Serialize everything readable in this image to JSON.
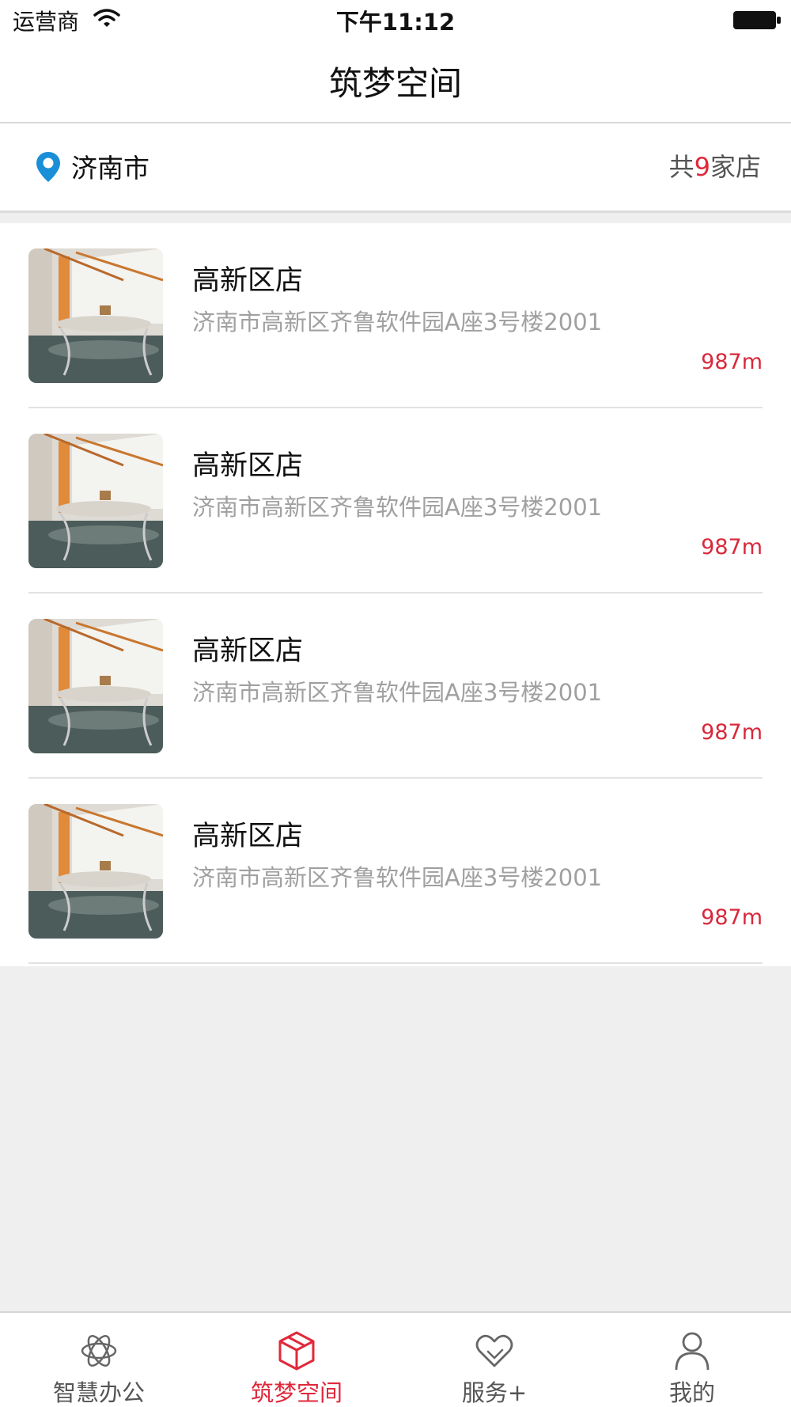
{
  "status_bar": {
    "carrier": "运营商",
    "time": "下午11:12"
  },
  "nav": {
    "title": "筑梦空间"
  },
  "location": {
    "city": "济南市",
    "count_prefix": "共",
    "count": "9",
    "count_suffix": "家店"
  },
  "stores": [
    {
      "name": "高新区店",
      "address": "济南市高新区齐鲁软件园A座3号楼2001",
      "distance": "987m"
    },
    {
      "name": "高新区店",
      "address": "济南市高新区齐鲁软件园A座3号楼2001",
      "distance": "987m"
    },
    {
      "name": "高新区店",
      "address": "济南市高新区齐鲁软件园A座3号楼2001",
      "distance": "987m"
    },
    {
      "name": "高新区店",
      "address": "济南市高新区齐鲁软件园A座3号楼2001",
      "distance": "987m"
    }
  ],
  "tabs": [
    {
      "label": "智慧办公",
      "icon": "atom-icon"
    },
    {
      "label": "筑梦空间",
      "icon": "box-icon",
      "active": true
    },
    {
      "label": "服务+",
      "icon": "heart-tag-icon"
    },
    {
      "label": "我的",
      "icon": "person-icon"
    }
  ],
  "colors": {
    "accent": "#e0283a",
    "pin": "#1a8fd8",
    "background": "#efefef"
  }
}
